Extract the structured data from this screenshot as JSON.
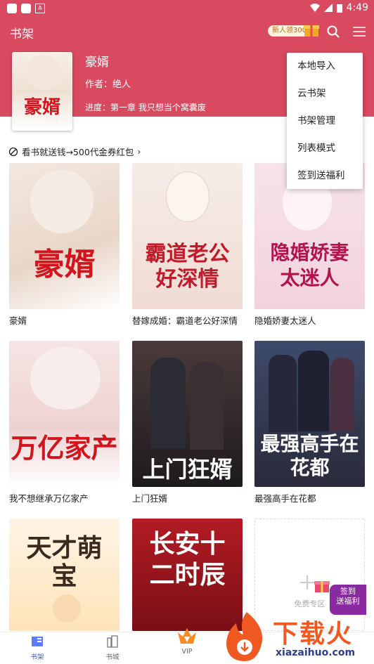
{
  "status": {
    "time": "4:49"
  },
  "header": {
    "title": "书架",
    "newbie_badge": "新人领300"
  },
  "hero": {
    "title": "豪婿",
    "author": "作者：绝人",
    "progress": "进度：第一章 我只想当个窝囊废",
    "cover_title": "豪婿"
  },
  "promo": {
    "text": "看书就送钱→500代金券红包",
    "chevron": "›"
  },
  "books": [
    {
      "name": "豪婿",
      "cover_text": "豪婿",
      "cover_colors": [
        "#f3e8df",
        "#e9d6c9"
      ]
    },
    {
      "name": "替嫁成婚：霸道老公好深情",
      "cover_text": "霸道老公好深情",
      "cover_colors": [
        "#f6ece8",
        "#f0dcd3"
      ]
    },
    {
      "name": "隐婚娇妻太迷人",
      "cover_text": "隐婚娇妻太迷人",
      "cover_colors": [
        "#f7e3ea",
        "#f2d2de"
      ]
    },
    {
      "name": "我不想继承万亿家产",
      "cover_text": "万亿家产",
      "cover_colors": [
        "#f6e4e4",
        "#e9c9c9"
      ]
    },
    {
      "name": "上门狂婿",
      "cover_text": "上门狂婿",
      "cover_colors": [
        "#2a2a30",
        "#8a6a60"
      ]
    },
    {
      "name": "最强高手在花都",
      "cover_text": "最强高手在花都",
      "cover_colors": [
        "#2f3a55",
        "#6b5a7a"
      ]
    },
    {
      "name": "",
      "cover_text": "天才萌宝",
      "cover_colors": [
        "#fff5e6",
        "#ffe3b8"
      ]
    },
    {
      "name": "",
      "cover_text": "长安十二时辰",
      "cover_colors": [
        "#b31b24",
        "#7a0f15"
      ]
    },
    {
      "name": "",
      "cover_text": "免费专区",
      "cover_colors": [
        "#ffffff",
        "#ffffff"
      ]
    }
  ],
  "menu": {
    "items": [
      "本地导入",
      "云书架",
      "书架管理",
      "列表模式",
      "签到送福利"
    ]
  },
  "fab": {
    "line1": "签到",
    "line2": "送福利"
  },
  "tabs": [
    {
      "label": "书架",
      "active": true
    },
    {
      "label": "书城",
      "active": false
    },
    {
      "label": "VIP",
      "active": false
    }
  ],
  "watermark": {
    "brand": "下载火",
    "url": "xiazaihuo.com"
  },
  "colors": {
    "brand": "#d94a60",
    "white": "#ffffff"
  }
}
